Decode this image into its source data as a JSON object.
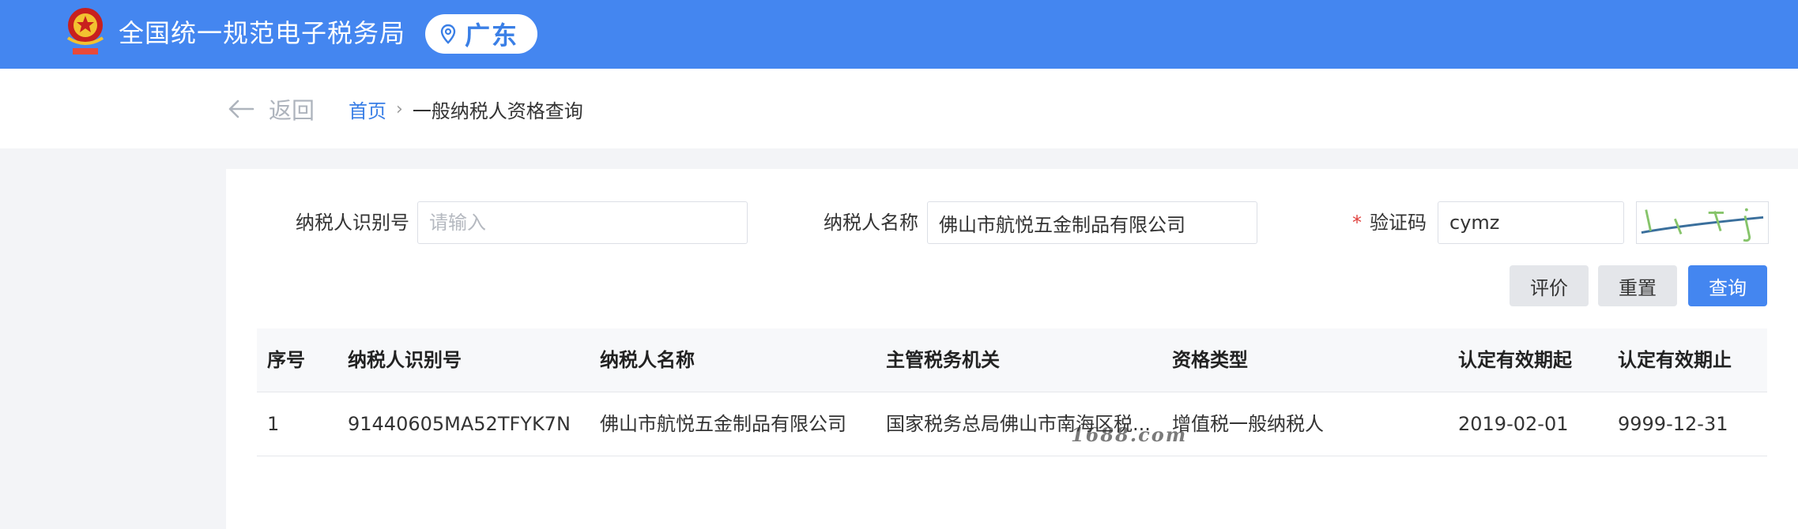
{
  "header": {
    "app_title": "全国统一规范电子税务局",
    "region": "广东",
    "emblem_icon": "national-emblem-icon",
    "pin_icon": "location-pin-icon",
    "color": "#4486f0"
  },
  "breadcrumb": {
    "back_label": "返回",
    "home": "首页",
    "separator": "›",
    "current": "一般纳税人资格查询"
  },
  "form": {
    "taxpayer_id_label": "纳税人识别号",
    "taxpayer_id_placeholder": "请输入",
    "taxpayer_id_value": "",
    "taxpayer_name_label": "纳税人名称",
    "taxpayer_name_value": "佛山市航悦五金制品有限公司",
    "captcha_required_mark": "*",
    "captcha_label": "验证码",
    "captcha_value": "cymz"
  },
  "watermark": "1688.com",
  "buttons": {
    "evaluate": "评价",
    "reset": "重置",
    "query": "查询"
  },
  "table": {
    "columns": [
      "序号",
      "纳税人识别号",
      "纳税人名称",
      "主管税务机关",
      "资格类型",
      "认定有效期起",
      "认定有效期止"
    ],
    "rows": [
      [
        "1",
        "91440605MA52TFYK7N",
        "佛山市航悦五金制品有限公司",
        "国家税务总局佛山市南海区税...",
        "增值税一般纳税人",
        "2019-02-01",
        "9999-12-31"
      ]
    ]
  }
}
